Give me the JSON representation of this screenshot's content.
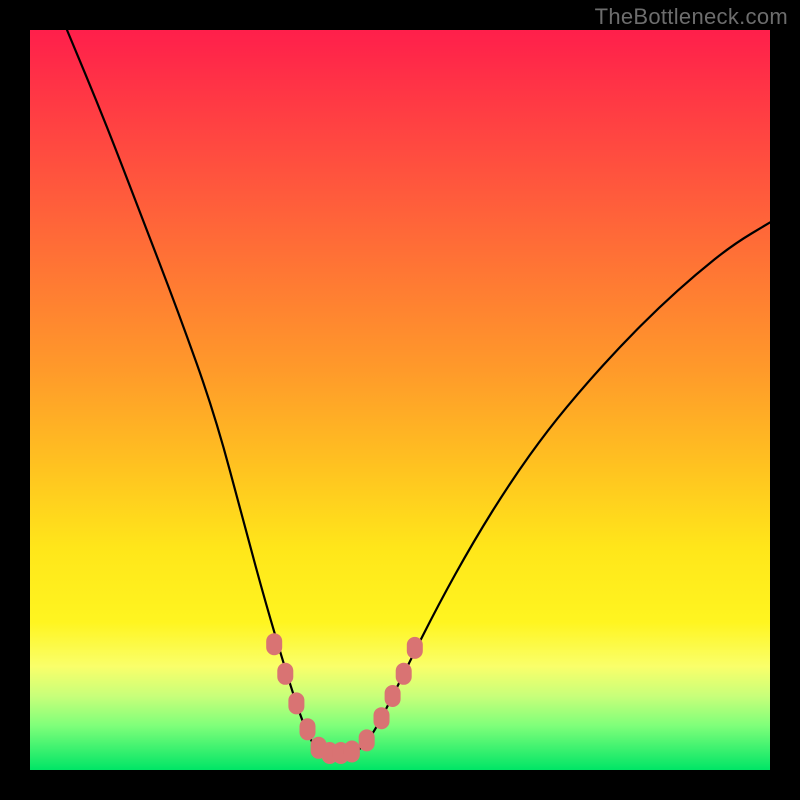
{
  "watermark": "TheBottleneck.com",
  "colors": {
    "page_bg": "#000000",
    "gradient_top": "#ff1f4b",
    "gradient_bottom": "#00e566",
    "curve": "#000000",
    "marker": "#d97373"
  },
  "chart_data": {
    "type": "line",
    "title": "",
    "xlabel": "",
    "ylabel": "",
    "xlim": [
      0,
      100
    ],
    "ylim": [
      0,
      100
    ],
    "grid": false,
    "legend": false,
    "annotations": [],
    "series": [
      {
        "name": "bottleneck-curve",
        "x": [
          5,
          10,
          15,
          20,
          25,
          29,
          32,
          35,
          37,
          38.5,
          40,
          41.5,
          43,
          45,
          47,
          50,
          55,
          60,
          65,
          70,
          75,
          80,
          85,
          90,
          95,
          100
        ],
        "values": [
          100,
          88,
          75,
          62,
          48,
          33,
          22,
          12,
          6,
          3,
          2,
          2,
          2,
          3,
          6,
          12,
          22,
          31,
          39,
          46,
          52,
          57.5,
          62.5,
          67,
          71,
          74
        ]
      }
    ],
    "markers": {
      "name": "highlighted-points",
      "points": [
        {
          "x": 33,
          "y": 17
        },
        {
          "x": 34.5,
          "y": 13
        },
        {
          "x": 36,
          "y": 9
        },
        {
          "x": 37.5,
          "y": 5.5
        },
        {
          "x": 39,
          "y": 3
        },
        {
          "x": 40.5,
          "y": 2.3
        },
        {
          "x": 42,
          "y": 2.3
        },
        {
          "x": 43.5,
          "y": 2.5
        },
        {
          "x": 45.5,
          "y": 4
        },
        {
          "x": 47.5,
          "y": 7
        },
        {
          "x": 49,
          "y": 10
        },
        {
          "x": 50.5,
          "y": 13
        },
        {
          "x": 52,
          "y": 16.5
        }
      ]
    }
  }
}
